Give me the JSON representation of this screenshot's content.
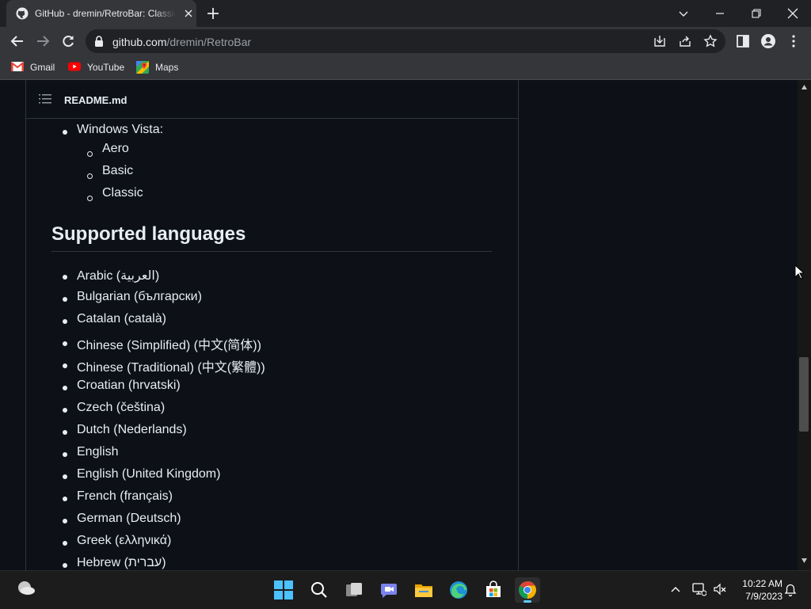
{
  "browser": {
    "tab_title": "GitHub - dremin/RetroBar: Classic Taskbar",
    "url_host": "github.com",
    "url_path": "/dremin/RetroBar",
    "bookmarks": [
      "Gmail",
      "YouTube",
      "Maps"
    ]
  },
  "readme": {
    "filename": "README.md",
    "vista_item": "Windows Vista:",
    "vista_themes": [
      "Aero",
      "Basic",
      "Classic"
    ],
    "languages_heading": "Supported languages",
    "languages": [
      "Arabic (العربية)",
      "Bulgarian (български)",
      "Catalan (català)",
      "Chinese (Simplified) (中文(简体))",
      "Chinese (Traditional) (中文(繁體))",
      "Croatian (hrvatski)",
      "Czech (čeština)",
      "Dutch (Nederlands)",
      "English",
      "English (United Kingdom)",
      "French (français)",
      "German (Deutsch)",
      "Greek (ελληνικά)",
      "Hebrew (עברית)"
    ]
  },
  "taskbar": {
    "time": "10:22 AM",
    "date": "7/9/2023"
  },
  "colors": {
    "page_bg": "#0d1117",
    "chrome_frame": "#202124",
    "chrome_toolbar": "#35363a",
    "border": "#30363d",
    "taskbar": "#1c1c1c",
    "accent": "#60cdff"
  }
}
